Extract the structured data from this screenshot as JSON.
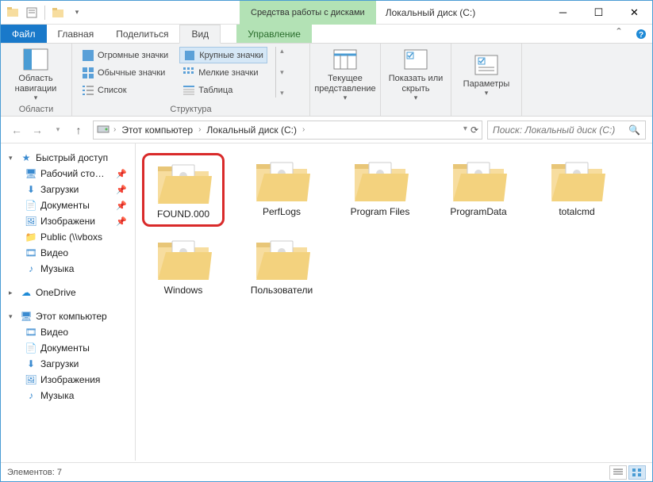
{
  "titlebar": {
    "context_tab": "Средства работы с дисками",
    "title": "Локальный диск (C:)"
  },
  "ribbon_tabs": {
    "file": "Файл",
    "home": "Главная",
    "share": "Поделиться",
    "view": "Вид",
    "manage": "Управление"
  },
  "ribbon": {
    "nav_pane": "Область навигации",
    "group_panes": "Области",
    "layout": {
      "huge": "Огромные значки",
      "large": "Крупные значки",
      "medium": "Обычные значки",
      "small": "Мелкие значки",
      "list": "Список",
      "details": "Таблица"
    },
    "group_layout": "Структура",
    "current_view": "Текущее представление",
    "show_hide": "Показать или скрыть",
    "options": "Параметры"
  },
  "breadcrumb": {
    "root": "Этот компьютер",
    "drive": "Локальный диск (C:)"
  },
  "search": {
    "placeholder": "Поиск: Локальный диск (C:)"
  },
  "sidebar": {
    "quick": "Быстрый доступ",
    "desktop": "Рабочий сто…",
    "downloads": "Загрузки",
    "documents": "Документы",
    "pictures": "Изображени",
    "public": "Public (\\\\vboxs",
    "videos": "Видео",
    "music": "Музыка",
    "onedrive": "OneDrive",
    "thispc": "Этот компьютер",
    "videos2": "Видео",
    "documents2": "Документы",
    "downloads2": "Загрузки",
    "pictures2": "Изображения",
    "music2": "Музыка"
  },
  "folders": [
    {
      "name": "FOUND.000",
      "highlight": true
    },
    {
      "name": "PerfLogs"
    },
    {
      "name": "Program Files"
    },
    {
      "name": "ProgramData"
    },
    {
      "name": "totalcmd"
    },
    {
      "name": "Windows"
    },
    {
      "name": "Пользователи"
    }
  ],
  "statusbar": {
    "count": "Элементов: 7"
  }
}
